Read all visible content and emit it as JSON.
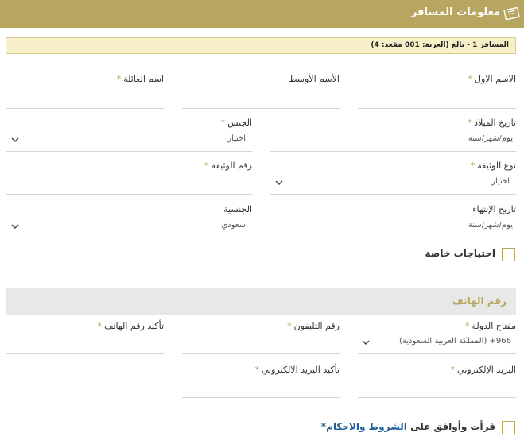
{
  "header": {
    "title": "معلومات المسافر"
  },
  "notice": {
    "text": "المسافر 1 - بالغ (العربة: 001 مقعد: 4)"
  },
  "fields": {
    "first_name": {
      "label": "الاسم الاول"
    },
    "middle_name": {
      "label": "الأسم الأوسط"
    },
    "family_name": {
      "label": "اسم العائلة"
    },
    "birth_date": {
      "label": "تاريخ الميلاد",
      "placeholder": "يوم/شهر/سنة"
    },
    "gender": {
      "label": "الجنس",
      "value": "اختيار"
    },
    "doc_type": {
      "label": "نوع الوثيقة",
      "value": "اختيار"
    },
    "doc_number": {
      "label": "رقم الوثيقة"
    },
    "expiry_date": {
      "label": "تاريخ الإنتهاء",
      "placeholder": "يوم/شهر/سنة"
    },
    "nationality": {
      "label": "الجنسية",
      "value": "سعودي"
    }
  },
  "special_needs": {
    "label": "احتياجات خاصة"
  },
  "phone_section": {
    "title": "رقم الهاتف"
  },
  "contact": {
    "country_code": {
      "label": "مفتاح الدولة",
      "value": "966+ (المملكة العربية السعودية)"
    },
    "phone": {
      "label": "رقم التليفون"
    },
    "phone_confirm": {
      "label": "تأكيد رقم الهاتف"
    },
    "email": {
      "label": "البريد الإلكتروني"
    },
    "email_confirm": {
      "label": "تأكيد البريد الالكتروني"
    }
  },
  "terms": {
    "prefix": "قرأت وأوافق على ",
    "link": "الشروط والاحكام",
    "suffix": "*"
  },
  "required_mark": "*",
  "colors": {
    "accent": "#b7a560",
    "link": "#1f5f9a"
  }
}
